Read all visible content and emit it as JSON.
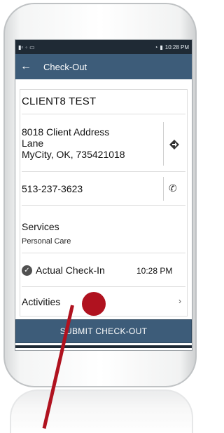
{
  "status_bar": {
    "time": "10:28 PM"
  },
  "app_bar": {
    "title": "Check-Out"
  },
  "client": {
    "name": "CLIENT8 TEST",
    "address_line1": "8018 Client Address",
    "address_line2": "Lane",
    "address_line3": "MyCity, OK, 735421018",
    "phone": "513-237-3623"
  },
  "services": {
    "label": "Services",
    "value": "Personal Care"
  },
  "checkin": {
    "label": "Actual Check-In",
    "time": "10:28 PM"
  },
  "activities": {
    "label": "Activities"
  },
  "submit": {
    "label": "SUBMIT CHECK-OUT"
  }
}
